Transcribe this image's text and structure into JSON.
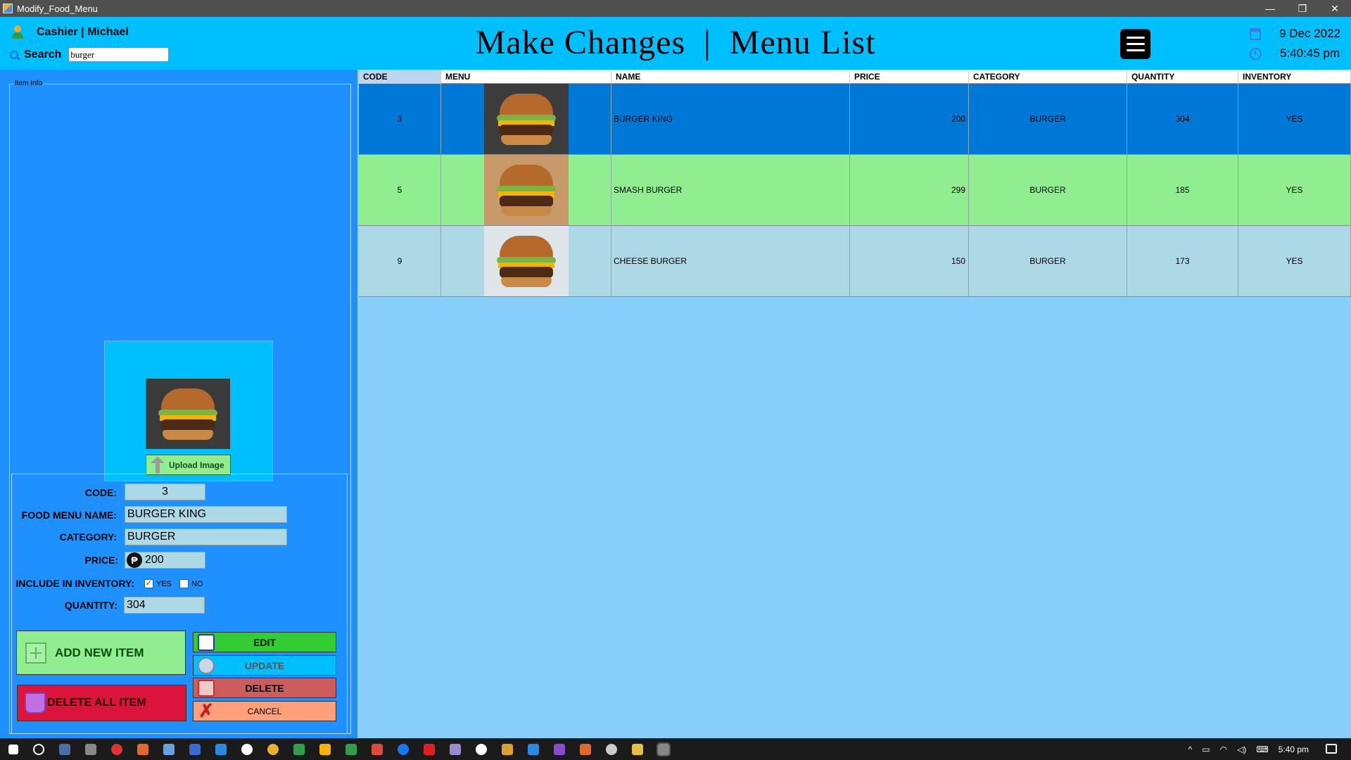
{
  "window": {
    "title": "Modify_Food_Menu",
    "minimize": "—",
    "restore": "❐",
    "close": "✕"
  },
  "header": {
    "user": "Cashier | Michael",
    "search_label": "Search",
    "search_value": "burger",
    "title": "Make Changes  |  Menu List",
    "date": "9 Dec 2022",
    "time": "5:40:45 pm"
  },
  "item_info": {
    "legend": "Item Info",
    "upload_label": "Upload Image",
    "labels": {
      "code": "CODE:",
      "name": "FOOD MENU NAME:",
      "category": "CATEGORY:",
      "price": "PRICE:",
      "inventory": "INCLUDE IN INVENTORY:",
      "quantity": "QUANTITY:"
    },
    "values": {
      "code": "3",
      "name": "BURGER KING",
      "category": "BURGER",
      "price": "200",
      "quantity": "304"
    },
    "peso_symbol": "₱",
    "inventory_yes": "YES",
    "inventory_no": "NO",
    "inventory_yes_checked": true
  },
  "buttons": {
    "add": "ADD NEW ITEM",
    "delete_all": "DELETE ALL ITEM",
    "edit": "EDIT",
    "update": "UPDATE",
    "delete": "DELETE",
    "cancel": "CANCEL"
  },
  "table": {
    "columns": [
      "CODE",
      "MENU",
      "NAME",
      "PRICE",
      "CATEGORY",
      "QUANTITY",
      "INVENTORY"
    ],
    "rows": [
      {
        "code": "3",
        "name": "BURGER KING",
        "price": "200",
        "category": "BURGER",
        "quantity": "304",
        "inventory": "YES"
      },
      {
        "code": "5",
        "name": "SMASH BURGER",
        "price": "299",
        "category": "BURGER",
        "quantity": "185",
        "inventory": "YES"
      },
      {
        "code": "9",
        "name": "CHEESE BURGER",
        "price": "150",
        "category": "BURGER",
        "quantity": "173",
        "inventory": "YES"
      }
    ]
  },
  "taskbar": {
    "clock": "5:40 pm"
  },
  "colors": {
    "header_bg": "#00bfff",
    "panel_bg": "#1e90ff",
    "grid_bg": "#87cefa",
    "row_selected": "#0078d7",
    "row_alt": "#90ee90",
    "row_light": "#add8e6"
  }
}
